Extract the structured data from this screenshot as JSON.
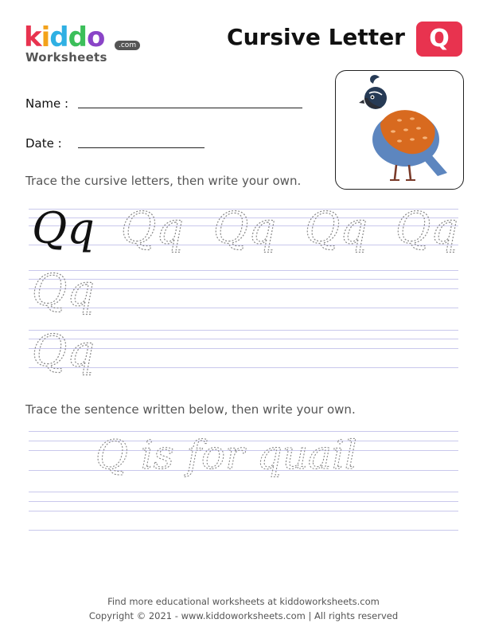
{
  "logo": {
    "letters": [
      "k",
      "i",
      "d",
      "d",
      "o"
    ],
    "letter_colors": [
      "#e8334f",
      "#f3a21b",
      "#2fb0e3",
      "#3cbf5a",
      "#8a44c7"
    ],
    "sub": "Worksheets",
    "com": ".com"
  },
  "header": {
    "title": "Cursive Letter",
    "letter": "Q",
    "badge_color": "#e8334f"
  },
  "fields": {
    "name_label": "Name :",
    "date_label": "Date :"
  },
  "picture": {
    "subject": "quail-illustration"
  },
  "instructions": {
    "letters": "Trace the cursive letters, then write your own.",
    "sentence": "Trace the sentence written below, then write your own."
  },
  "practice": {
    "model": "Qq",
    "trace_row1": [
      "Qq",
      "Qq",
      "Qq",
      "Qq"
    ],
    "trace_left": [
      "Qq",
      "Qq"
    ],
    "sentence": "Q is for quail"
  },
  "footer": {
    "line1": "Find more educational worksheets at kiddoworksheets.com",
    "line2": "Copyright © 2021 - www.kiddoworksheets.com  |  All rights reserved"
  }
}
